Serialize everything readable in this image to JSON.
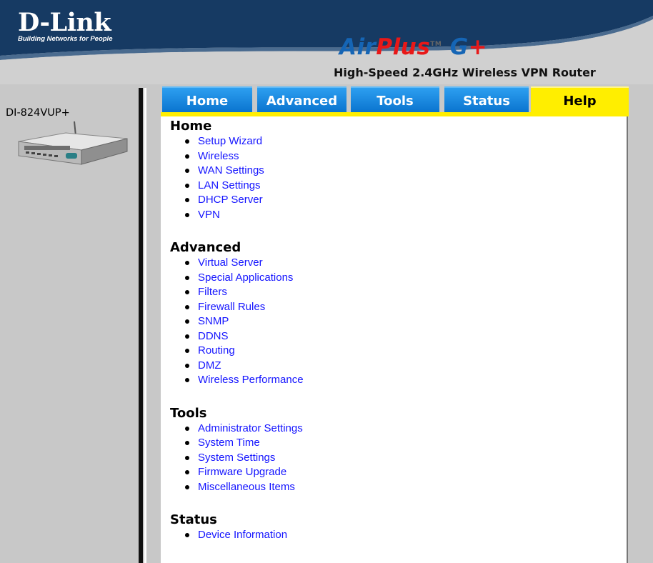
{
  "header": {
    "brand_name": "D-Link",
    "brand_tagline": "Building Networks for People",
    "product_air": "Air",
    "product_plus": "Plus",
    "product_tm": "TM",
    "product_g": "G",
    "product_gplus": "+",
    "subtitle": "High-Speed 2.4GHz Wireless VPN Router"
  },
  "sidebar": {
    "model": "DI-824VUP+"
  },
  "tabs": [
    {
      "label": "Home",
      "active": false
    },
    {
      "label": "Advanced",
      "active": false
    },
    {
      "label": "Tools",
      "active": false
    },
    {
      "label": "Status",
      "active": false
    },
    {
      "label": "Help",
      "active": true
    }
  ],
  "sections": [
    {
      "title": "Home",
      "items": [
        "Setup Wizard",
        "Wireless",
        "WAN Settings",
        "LAN Settings",
        "DHCP Server",
        "VPN"
      ]
    },
    {
      "title": "Advanced",
      "items": [
        "Virtual Server",
        "Special Applications",
        "Filters",
        "Firewall Rules",
        "SNMP",
        "DDNS",
        "Routing",
        "DMZ",
        "Wireless Performance"
      ]
    },
    {
      "title": "Tools",
      "items": [
        "Administrator Settings",
        "System Time",
        "System Settings",
        "Firmware Upgrade",
        "Miscellaneous Items"
      ]
    },
    {
      "title": "Status",
      "items": [
        "Device Information"
      ]
    }
  ],
  "colors": {
    "header_blue": "#17375e",
    "tab_blue": "#0a74cf",
    "tab_active": "#ffee00",
    "link": "#1414ff"
  }
}
